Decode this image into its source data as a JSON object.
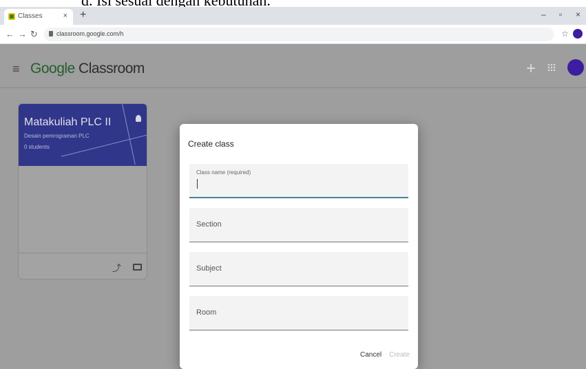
{
  "doc_caption": "d.   Isi sesuai dengan kebutuhan.",
  "browser": {
    "tab_title": "Classes",
    "url": "classroom.google.com/h",
    "min": "–",
    "max": "▫",
    "close": "×",
    "new_tab": "+"
  },
  "app": {
    "brand_g": "Google",
    "brand_rest": " Classroom"
  },
  "card": {
    "title": "Matakuliah PLC II",
    "section": "Desain pemrograman PLC",
    "students": "0 students"
  },
  "dialog": {
    "title": "Create class",
    "fields": [
      {
        "label": "Class name (required)",
        "value": ""
      },
      {
        "label": "Section",
        "value": ""
      },
      {
        "label": "Subject",
        "value": ""
      },
      {
        "label": "Room",
        "value": ""
      }
    ],
    "cancel": "Cancel",
    "create": "Create"
  }
}
